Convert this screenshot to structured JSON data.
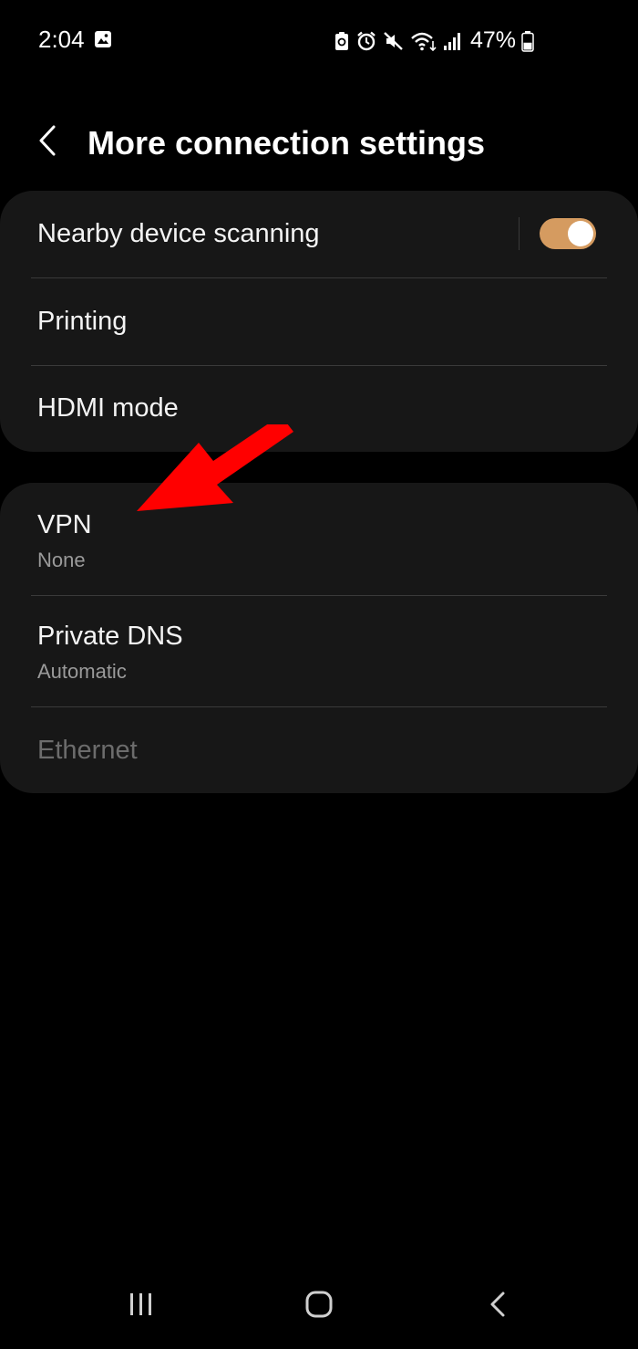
{
  "status_bar": {
    "time": "2:04",
    "battery_percent": "47%",
    "battery_level": 0.47,
    "left_icons": [
      "gallery-icon"
    ],
    "right_icons": [
      "data-saver-icon",
      "alarm-icon",
      "mute-icon",
      "wifi-icon",
      "signal-icon",
      "battery-icon"
    ]
  },
  "header": {
    "title": "More connection settings",
    "back_icon": "chevron-left-icon"
  },
  "groups": {
    "device": {
      "nearby": {
        "title": "Nearby device scanning",
        "toggle_on": true
      },
      "printing": {
        "title": "Printing"
      },
      "hdmi": {
        "title": "HDMI mode"
      }
    },
    "network": {
      "vpn": {
        "title": "VPN",
        "subtitle": "None"
      },
      "dns": {
        "title": "Private DNS",
        "subtitle": "Automatic"
      },
      "ethernet": {
        "title": "Ethernet",
        "enabled": false
      }
    }
  },
  "annotation": {
    "icon": "red-arrow-icon",
    "color": "#ff0000"
  },
  "colors": {
    "background": "#000000",
    "card": "#171717",
    "toggle_on": "#d59b60",
    "subtitle": "#9a9a9a",
    "disabled": "#6c6c6c"
  },
  "nav_bar": {
    "icons": [
      "recent-apps-icon",
      "home-icon",
      "back-icon"
    ]
  }
}
